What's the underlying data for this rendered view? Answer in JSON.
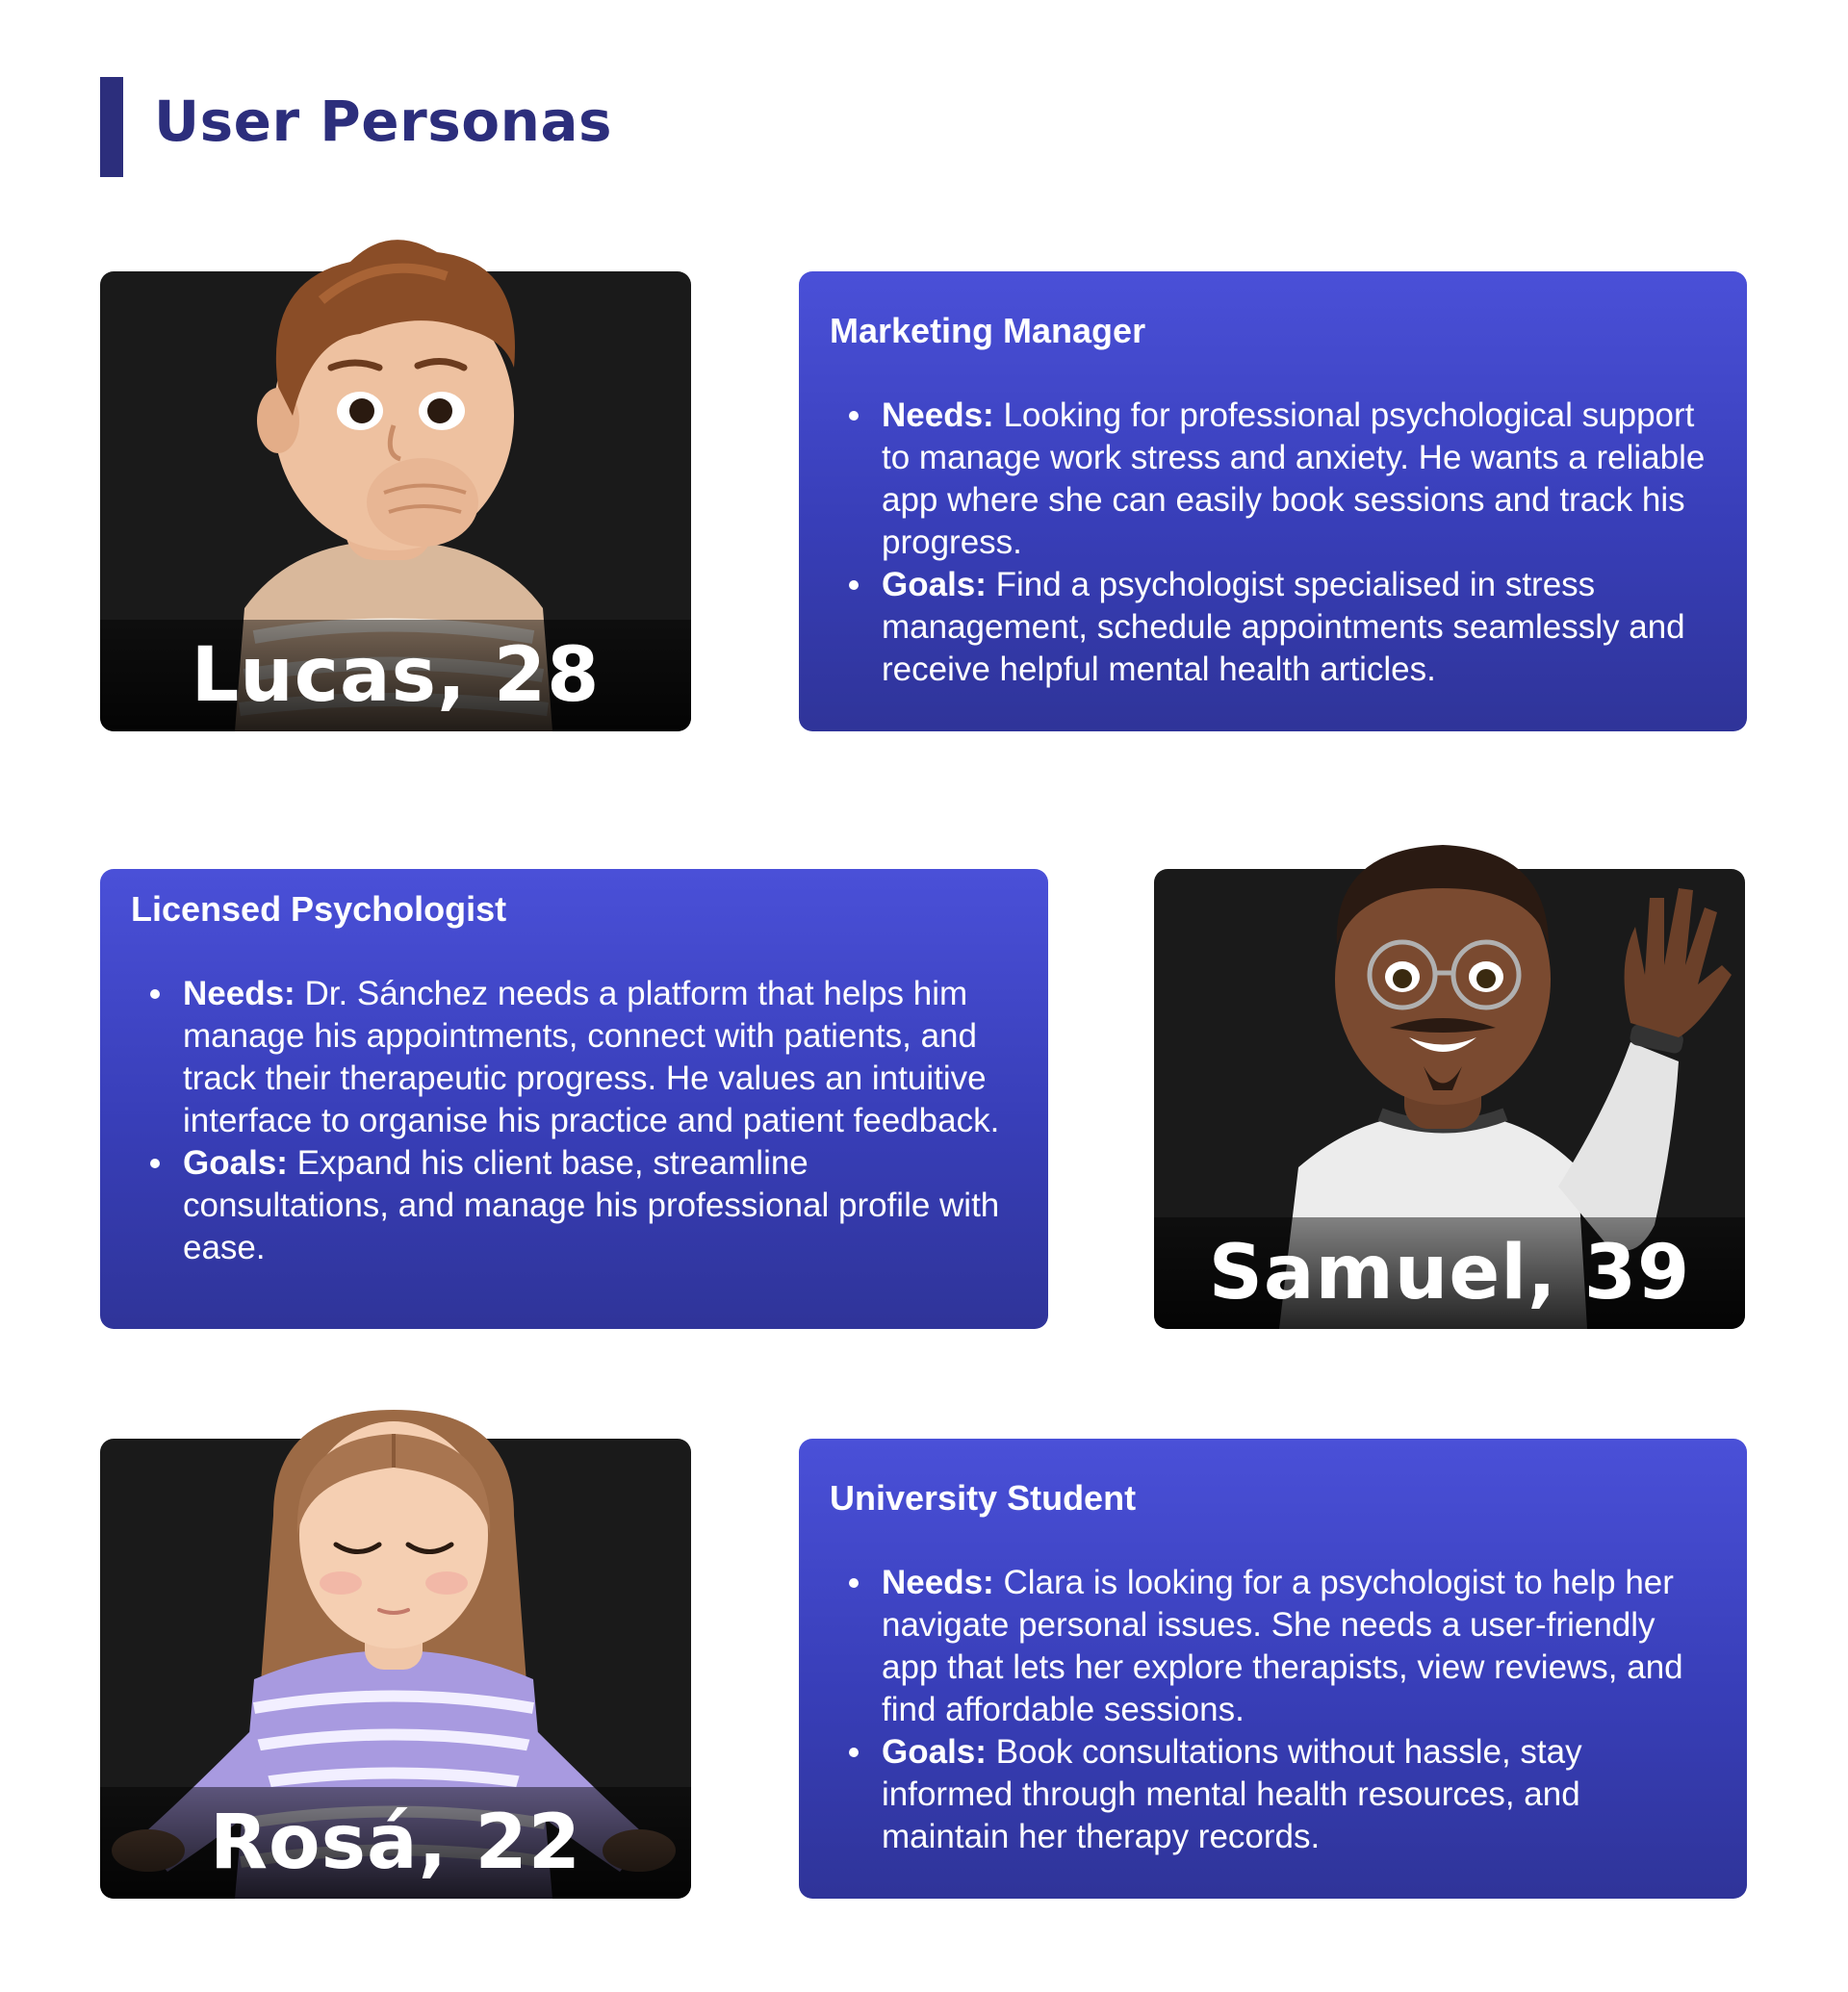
{
  "page": {
    "title": "User Personas"
  },
  "personas": [
    {
      "name": "Lucas, 28",
      "role": "Marketing Manager",
      "needs_label": "Needs:",
      "needs": "Looking for professional psychological support to manage work stress and anxiety. He wants a reliable app where she can easily book sessions and track his progress.",
      "goals_label": "Goals:",
      "goals": "Find a psychologist specialised in stress management, schedule appointments seamlessly and receive helpful mental health articles."
    },
    {
      "name": "Samuel, 39",
      "role": "Licensed Psychologist",
      "needs_label": "Needs:",
      "needs": "Dr. Sánchez needs a platform that helps him manage his appointments, connect with patients, and track their therapeutic progress. He values an intuitive interface to organise his practice and patient feedback.",
      "goals_label": "Goals:",
      "goals": "Expand his client base, streamline consultations, and manage his professional profile with ease."
    },
    {
      "name": "Rosá, 22",
      "role": "University Student",
      "needs_label": "Needs:",
      "needs": "Clara is looking for a psychologist to help her navigate personal issues. She needs a user-friendly app that lets her explore therapists, view reviews, and find affordable sessions.",
      "goals_label": "Goals:",
      "goals": "Book consultations without hassle, stay informed through mental health resources, and maintain her therapy records."
    }
  ],
  "colors": {
    "title": "#2c2e7c",
    "card_top": "#4a50d8",
    "card_bottom": "#2f3499",
    "photo_bg": "#1a1a1a"
  }
}
